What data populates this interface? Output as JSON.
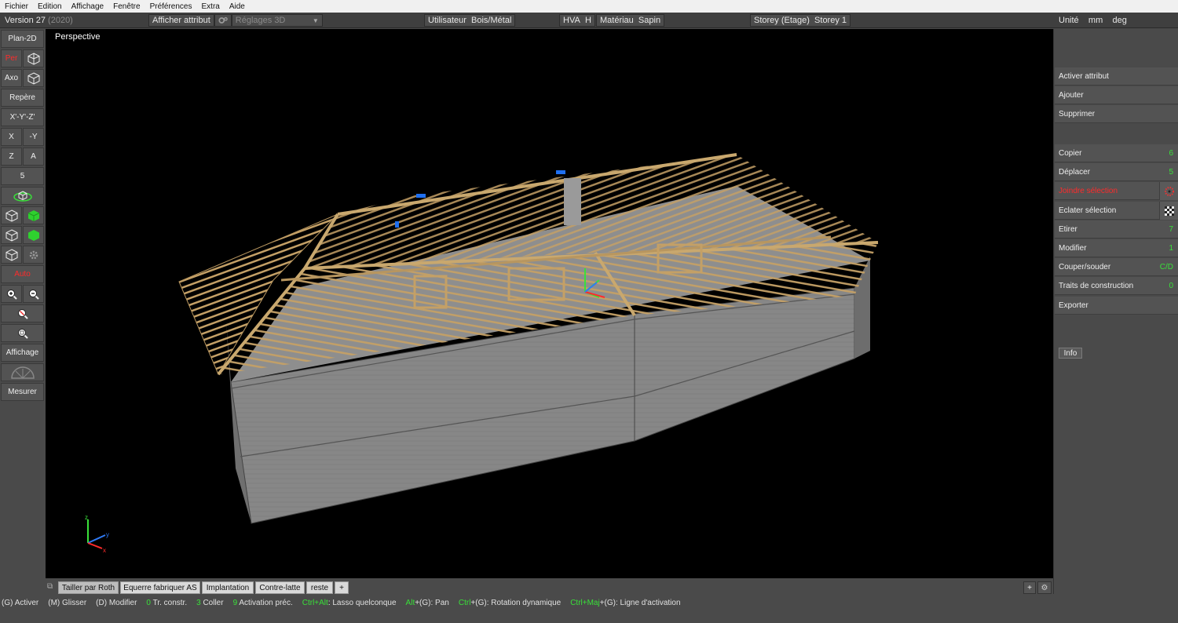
{
  "menu": [
    "Fichier",
    "Edition",
    "Affichage",
    "Fenêtre",
    "Préférences",
    "Extra",
    "Aide"
  ],
  "toolbar": {
    "version": "Version 27",
    "version_year": "(2020)",
    "afficher_attribut": "Afficher attribut",
    "reglages_3d": "Réglages 3D",
    "utilisateur_label": "Utilisateur",
    "utilisateur_value": "Bois/Métal",
    "hva_label": "HVA",
    "hva_value": "H",
    "materiau_label": "Matériau",
    "materiau_value": "Sapin",
    "storey_label": "Storey (Etage)",
    "storey_value": "Storey 1",
    "unite_label": "Unité",
    "unit_length": "mm",
    "unit_angle": "deg"
  },
  "left": {
    "plan2d": "Plan-2D",
    "per": "Per",
    "axo": "Axo",
    "repere": "Repère",
    "xyz": "X'-Y'-Z'",
    "x": "X",
    "my": "-Y",
    "z": "Z",
    "a": "A",
    "five": "5",
    "auto": "Auto",
    "affichage": "Affichage",
    "mesurer": "Mesurer"
  },
  "viewport": {
    "label": "Perspective",
    "axis_z": "z",
    "axis_y": "y",
    "axis_x": "x"
  },
  "right": {
    "activer_attribut": "Activer attribut",
    "ajouter": "Ajouter",
    "supprimer": "Supprimer",
    "copier": "Copier",
    "copier_key": "6",
    "deplacer": "Déplacer",
    "deplacer_key": "5",
    "joindre": "Joindre sélection",
    "eclater": "Eclater sélection",
    "etirer": "Etirer",
    "etirer_key": "7",
    "modifier": "Modifier",
    "modifier_key": "1",
    "couper": "Couper/souder",
    "couper_key": "C/D",
    "traits": "Traits de construction",
    "traits_key": "0",
    "exporter": "Exporter",
    "info": "Info"
  },
  "tabs": [
    "Tailler par Roth",
    "Equerre fabriquer AS",
    "Implantation",
    "Contre-latte",
    "reste",
    "+"
  ],
  "tabs_right": [
    "+",
    "⚙"
  ],
  "status": [
    {
      "key": "(G)",
      "text": "Activer"
    },
    {
      "key": "(M)",
      "text": "Glisser"
    },
    {
      "key": "(D)",
      "text": "Modifier"
    },
    {
      "gkey": "0",
      "text": "Tr. constr."
    },
    {
      "gkey": "3",
      "text": "Coller"
    },
    {
      "gkey": "9",
      "text": "Activation préc."
    },
    {
      "gkey": "Ctrl+Alt",
      "text": ": Lasso quelconque"
    },
    {
      "gkey": "Alt",
      "text": "+(G): Pan"
    },
    {
      "gkey": "Ctrl",
      "text": "+(G): Rotation dynamique"
    },
    {
      "gkey": "Ctrl+Maj",
      "text": "+(G): Ligne d'activation"
    }
  ],
  "colors": {
    "wood": "#b8965f",
    "wall": "#8a8a8a",
    "background": "#000000",
    "accent_green": "#39e039",
    "accent_red": "#ff2b2b"
  }
}
